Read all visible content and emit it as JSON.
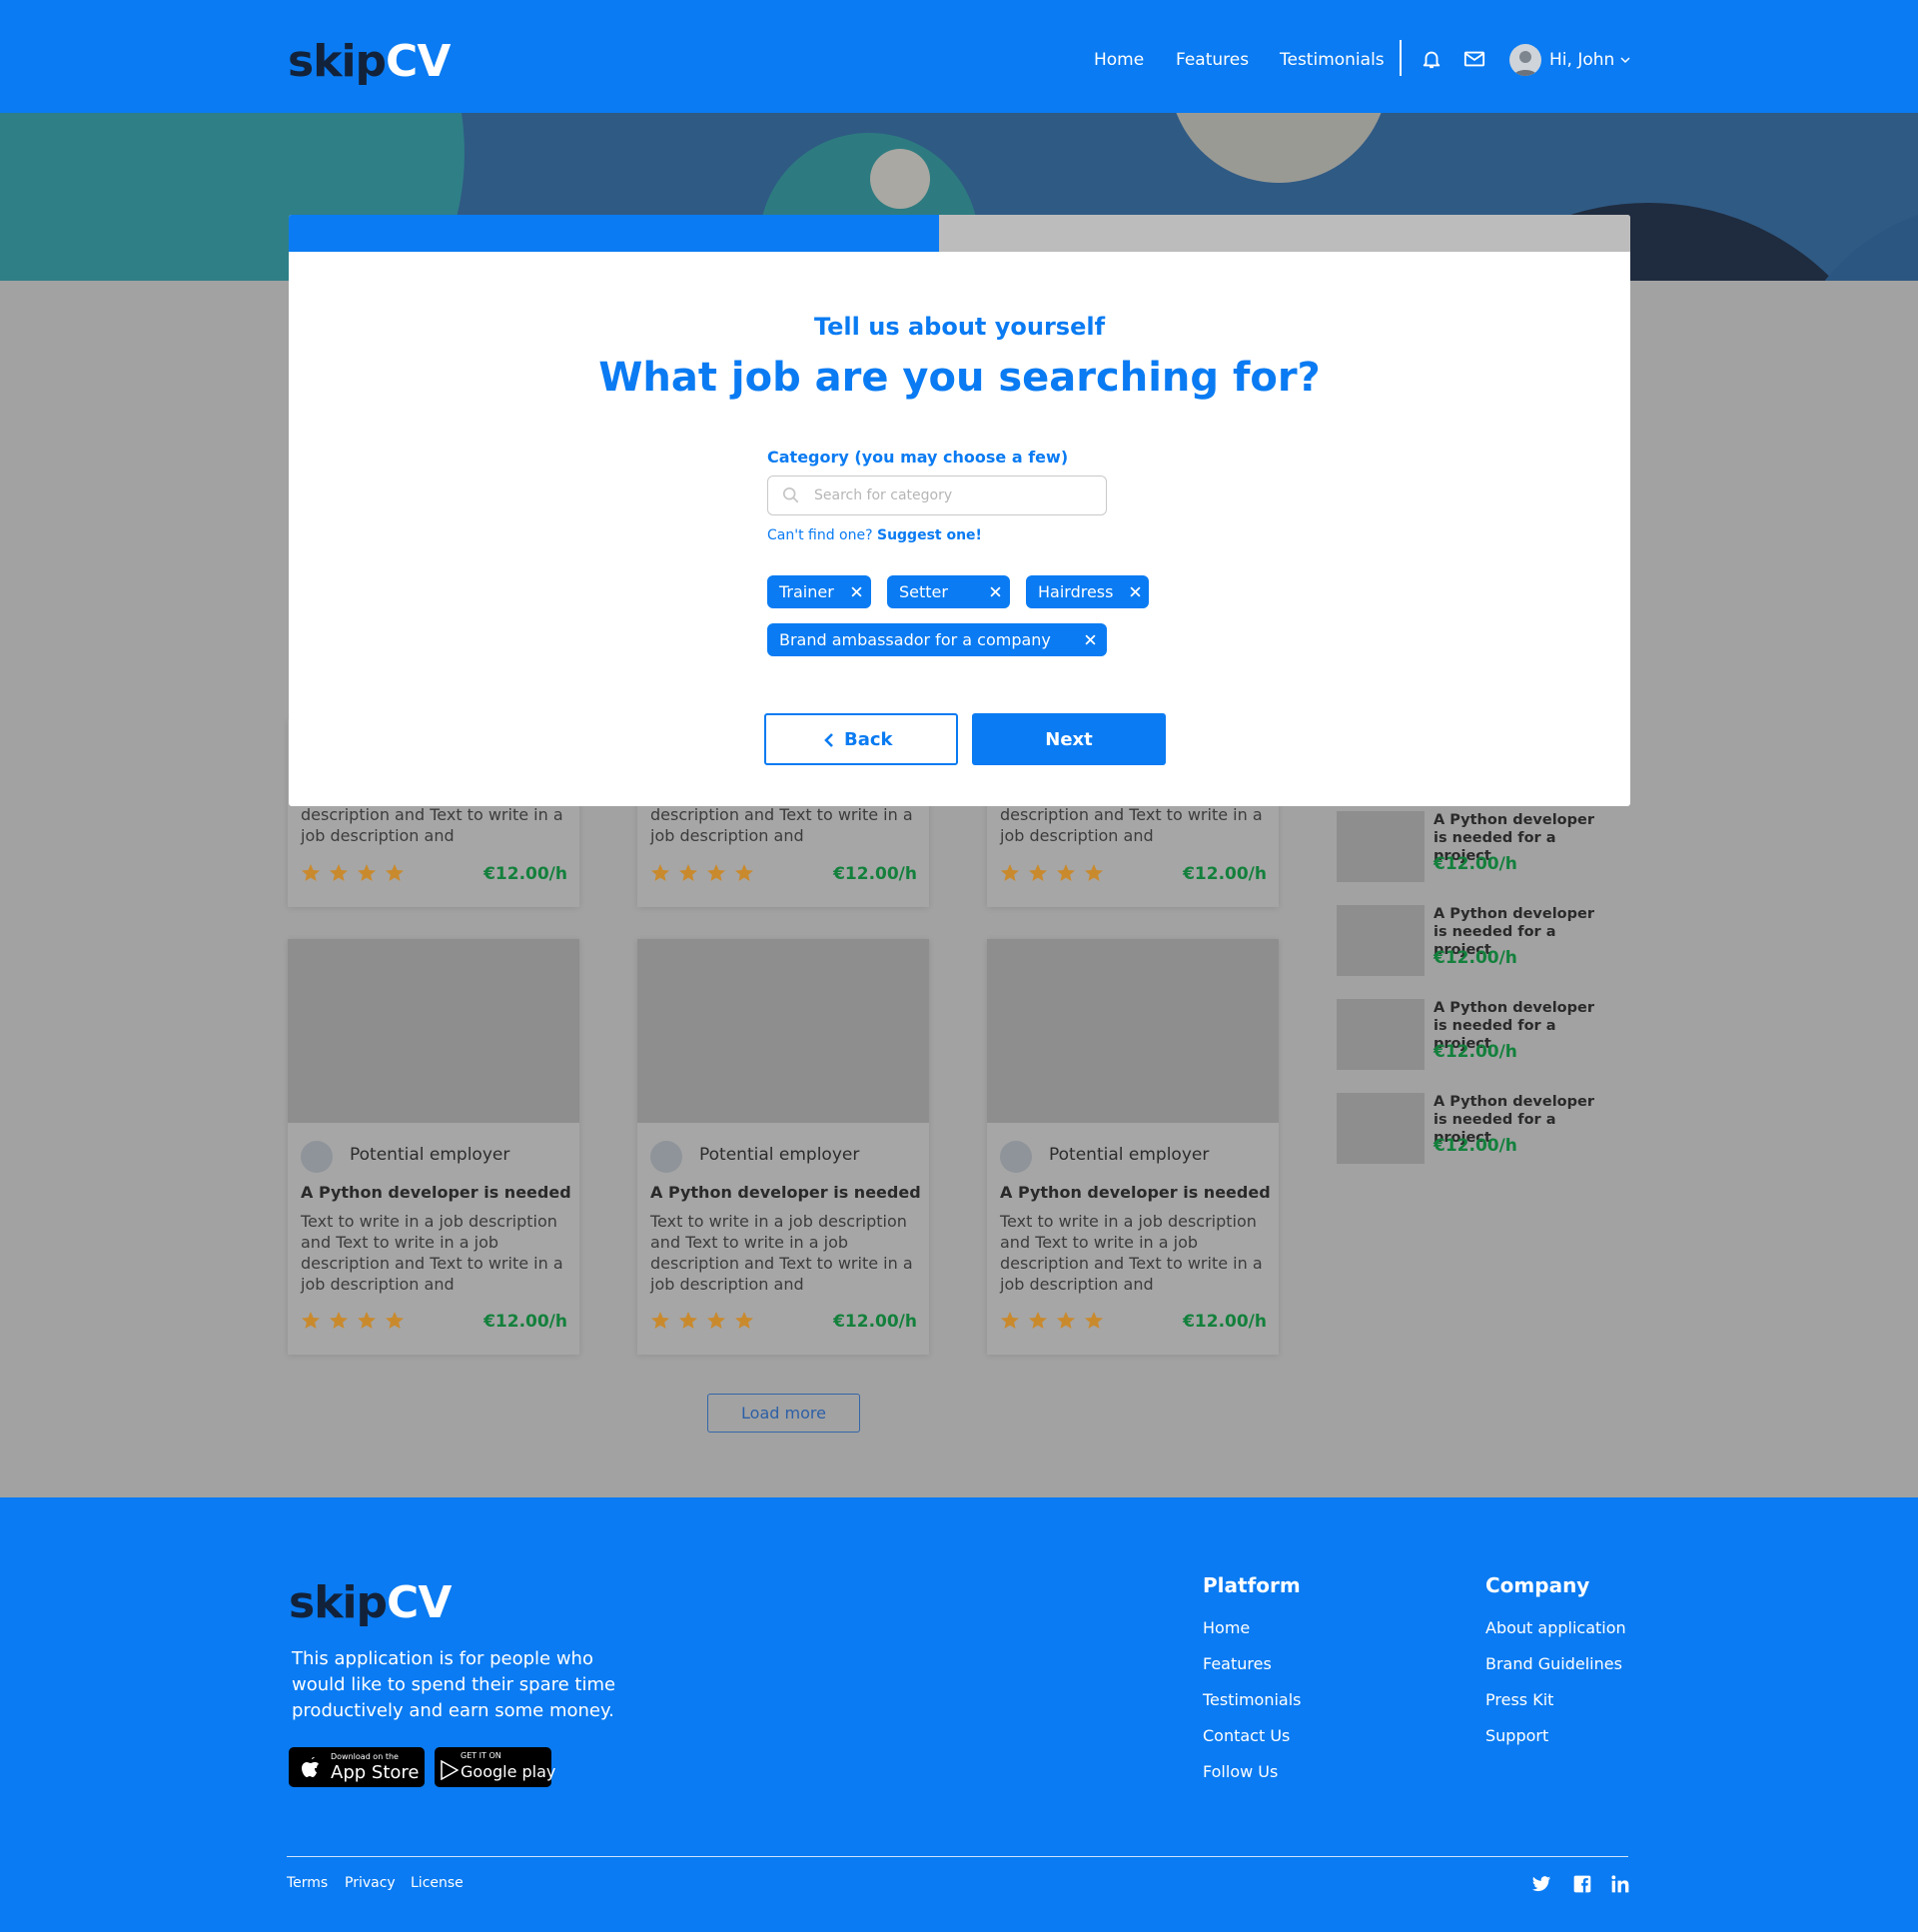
{
  "header": {
    "logo_part1": "skip",
    "logo_part2": "CV",
    "nav": [
      "Home",
      "Features",
      "Testimonials"
    ],
    "user_greeting": "Hi, John"
  },
  "cards": [
    {
      "desc": "description and Text to write in a job description and",
      "price": "€12.00/h",
      "rating": 4
    },
    {
      "desc": "description and Text to write in a job description and",
      "price": "€12.00/h",
      "rating": 4
    },
    {
      "desc": "description and Text to write in a job description and",
      "price": "€12.00/h",
      "rating": 4
    },
    {
      "employer": "Potential employer",
      "title": "A Python developer is needed",
      "desc": "Text to write in a job description and Text to write in a job description and Text to write in a job description and",
      "price": "€12.00/h",
      "rating": 4
    },
    {
      "employer": "Potential employer",
      "title": "A Python developer is needed",
      "desc": "Text to write in a job description and Text to write in a job description and Text to write in a job description and",
      "price": "€12.00/h",
      "rating": 4
    },
    {
      "employer": "Potential employer",
      "title": "A Python developer is needed",
      "desc": "Text to write in a job description and Text to write in a job description and Text to write in a job description and",
      "price": "€12.00/h",
      "rating": 4
    }
  ],
  "sidebar": [
    {
      "title": "A Python developer is needed for a project",
      "price": "€12.00/h"
    },
    {
      "title": "A Python developer is needed for a project",
      "price": "€12.00/h"
    },
    {
      "title": "A Python developer is needed for a project",
      "price": "€12.00/h"
    },
    {
      "title": "A Python developer is needed for a project",
      "price": "€12.00/h"
    }
  ],
  "load_more": "Load more",
  "modal": {
    "progress": 0.485,
    "subtitle": "Tell us about yourself",
    "title": "What job are you searching for?",
    "category_label": "Category (you may choose a few)",
    "search_placeholder": "Search for category",
    "hint": "Can't find one?",
    "hint_link": "Suggest one!",
    "chips": [
      "Trainer",
      "Setter",
      "Hairdress",
      "Brand ambassador for a company"
    ],
    "back": "Back",
    "next": "Next"
  },
  "footer": {
    "logo_part1": "skip",
    "logo_part2": "CV",
    "description": "This application is for people who would like to spend their spare time productively and earn some money.",
    "app_store_small": "Download on the",
    "app_store_big": "App Store",
    "google_small": "GET IT ON",
    "google_big": "Google play",
    "platform_heading": "Platform",
    "platform_links": [
      "Home",
      "Features",
      "Testimonials",
      "Contact Us",
      "Follow Us"
    ],
    "company_heading": "Company",
    "company_links": [
      "About application",
      "Brand Guidelines",
      "Press Kit",
      "Support"
    ],
    "legal": [
      "Terms",
      "Privacy",
      "License"
    ],
    "social_icons": [
      "twitter-icon",
      "facebook-icon",
      "linkedin-icon"
    ]
  },
  "colors": {
    "brand": "#0a7bf2",
    "price": "#13803c",
    "star": "#c98a2e"
  }
}
